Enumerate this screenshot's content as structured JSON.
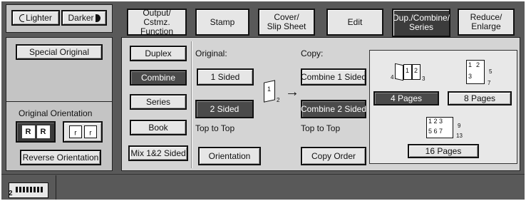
{
  "density": {
    "lighter": "Lighter",
    "darker": "Darker"
  },
  "left": {
    "special_original": "Special Original",
    "orientation_label": "Original Orientation",
    "reverse_orientation": "Reverse Orientation"
  },
  "tabs": [
    {
      "label": "Output/\nCstmz. Function"
    },
    {
      "label": "Stamp"
    },
    {
      "label": "Cover/\nSlip Sheet"
    },
    {
      "label": "Edit"
    },
    {
      "label": "Dup./Combine/\nSeries"
    },
    {
      "label": "Reduce/\nEnlarge"
    }
  ],
  "modes": [
    "Duplex",
    "Combine",
    "Series",
    "Book",
    "Mix 1&2 Sided"
  ],
  "original": {
    "heading": "Original:",
    "one_sided": "1 Sided",
    "two_sided": "2 Sided",
    "top_to_top": "Top to Top",
    "orientation": "Orientation"
  },
  "copy": {
    "heading": "Copy:",
    "combine_one": "Combine 1 Sided",
    "combine_two": "Combine 2 Sided",
    "top_to_top": "Top to Top",
    "copy_order": "Copy Order"
  },
  "pages": {
    "four": "4 Pages",
    "eight": "8 Pages",
    "sixteen": "16 Pages"
  },
  "icon_text": {
    "orig_num_1": "1",
    "orig_num_2": "2",
    "arrow": "→",
    "four_a": "4",
    "four_b": "1",
    "four_c": "2",
    "four_d": "3",
    "eight_1": "1",
    "eight_2": "2",
    "eight_3": "3",
    "eight_5": "5",
    "eight_7": "7",
    "sixteen_row1": "1 2 3",
    "sixteen_row2": "5 6 7",
    "sixteen_9": "9",
    "sixteen_13": "13"
  },
  "status": {
    "count": "2"
  },
  "colors": {
    "screen_bg": "#595959",
    "panel_bg": "#c4c4c4",
    "selected_bg": "#4a4a4a"
  }
}
